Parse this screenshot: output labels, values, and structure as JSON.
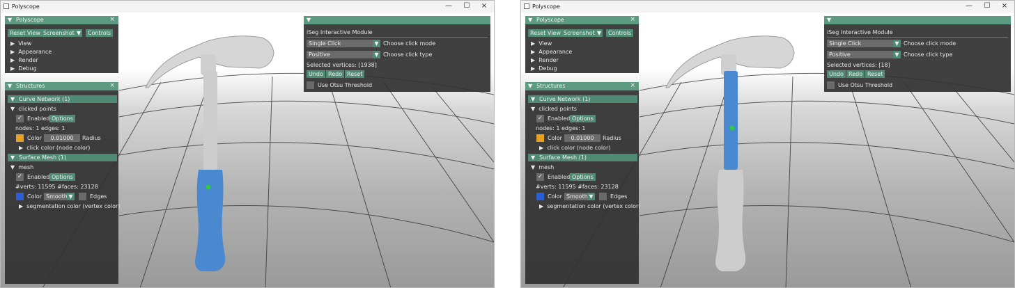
{
  "windows": [
    {
      "title": "Polyscope",
      "polyscope": {
        "title": "Polyscope",
        "reset_view": "Reset View",
        "screenshot": "Screenshot",
        "controls": "Controls",
        "items": [
          "View",
          "Appearance",
          "Render",
          "Debug"
        ]
      },
      "structures": {
        "title": "Structures",
        "curve_network_header": "Curve Network (1)",
        "curve_name": "clicked points",
        "enabled": "Enabled",
        "options": "Options",
        "nodes_edges": "nodes: 1  edges: 1",
        "color": "Color",
        "radius_value": "0.01000",
        "radius": "Radius",
        "click_color": "click color (node color)",
        "surface_mesh_header": "Surface Mesh (1)",
        "mesh_name": "mesh",
        "verts_faces": "#verts: 11595  #faces: 23128",
        "shade": "Smooth",
        "edges": "Edges",
        "seg_color": "segmentation color (vertex color)"
      },
      "iseg": {
        "title": "iSeg Interactive Module",
        "click_mode_value": "Single Click",
        "click_mode_label": "Choose click mode",
        "click_type_value": "Positive",
        "click_type_label": "Choose click type",
        "selected": "Selected vertices: [1938]",
        "undo": "Undo",
        "redo": "Redo",
        "reset": "Reset",
        "otsu": "Use Otsu Threshold"
      },
      "highlight": "grip"
    },
    {
      "title": "Polyscope",
      "polyscope": {
        "title": "Polyscope",
        "reset_view": "Reset View",
        "screenshot": "Screenshot",
        "controls": "Controls",
        "items": [
          "View",
          "Appearance",
          "Render",
          "Debug"
        ]
      },
      "structures": {
        "title": "Structures",
        "curve_network_header": "Curve Network (1)",
        "curve_name": "clicked points",
        "enabled": "Enabled",
        "options": "Options",
        "nodes_edges": "nodes: 1  edges: 1",
        "color": "Color",
        "radius_value": "0.01000",
        "radius": "Radius",
        "click_color": "click color (node color)",
        "surface_mesh_header": "Surface Mesh (1)",
        "mesh_name": "mesh",
        "verts_faces": "#verts: 11595  #faces: 23128",
        "shade": "Smooth",
        "edges": "Edges",
        "seg_color": "segmentation color (vertex color)"
      },
      "iseg": {
        "title": "iSeg Interactive Module",
        "click_mode_value": "Single Click",
        "click_mode_label": "Choose click mode",
        "click_type_value": "Positive",
        "click_type_label": "Choose click type",
        "selected": "Selected vertices: [18]",
        "undo": "Undo",
        "redo": "Redo",
        "reset": "Reset",
        "otsu": "Use Otsu Threshold"
      },
      "highlight": "shaft"
    }
  ],
  "colors": {
    "panel_header": "#5c9a82",
    "button": "#4e8a74",
    "curve_color": "#e8a020",
    "mesh_color": "#2a5fd6",
    "segmentation_blue": "#4a88d0",
    "click_point": "#2ecc40"
  },
  "icons": {
    "close": "×",
    "collapse": "▼",
    "expand": "▶",
    "check": "✓",
    "minimize": "—",
    "maximize": "☐"
  }
}
